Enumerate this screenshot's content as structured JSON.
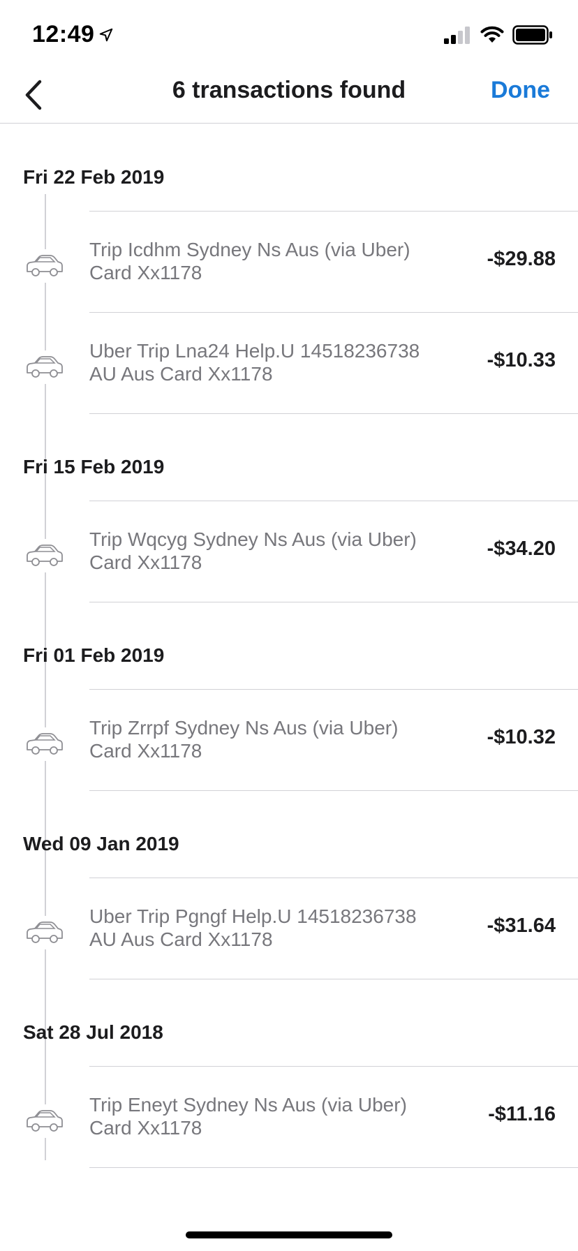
{
  "status_bar": {
    "time": "12:49",
    "icons": [
      "location-arrow-icon",
      "signal-icon",
      "wifi-icon",
      "battery-icon"
    ]
  },
  "nav": {
    "title": "6 transactions found",
    "done_label": "Done",
    "back_icon": "chevron-left-icon"
  },
  "colors": {
    "accent": "#1a7ad8",
    "divider": "#d1d1d6",
    "secondary_text": "#77777c",
    "primary_text": "#1c1c1e"
  },
  "groups": [
    {
      "date": "Fri 22 Feb 2019",
      "transactions": [
        {
          "icon": "car-icon",
          "description": "Trip Icdhm Sydney Ns Aus (via Uber) Card Xx1178",
          "amount": "-$29.88"
        },
        {
          "icon": "car-icon",
          "description": "Uber Trip Lna24 Help.U 14518236738 AU Aus Card Xx1178",
          "amount": "-$10.33"
        }
      ]
    },
    {
      "date": "Fri 15 Feb 2019",
      "transactions": [
        {
          "icon": "car-icon",
          "description": "Trip Wqcyg Sydney Ns Aus (via Uber) Card Xx1178",
          "amount": "-$34.20"
        }
      ]
    },
    {
      "date": "Fri 01 Feb 2019",
      "transactions": [
        {
          "icon": "car-icon",
          "description": "Trip Zrrpf Sydney Ns Aus (via Uber) Card Xx1178",
          "amount": "-$10.32"
        }
      ]
    },
    {
      "date": "Wed 09 Jan 2019",
      "transactions": [
        {
          "icon": "car-icon",
          "description": "Uber Trip Pgngf Help.U 14518236738 AU Aus Card Xx1178",
          "amount": "-$31.64"
        }
      ]
    },
    {
      "date": "Sat 28 Jul 2018",
      "transactions": [
        {
          "icon": "car-icon",
          "description": "Trip Eneyt Sydney Ns Aus (via Uber) Card Xx1178",
          "amount": "-$11.16"
        }
      ]
    }
  ]
}
